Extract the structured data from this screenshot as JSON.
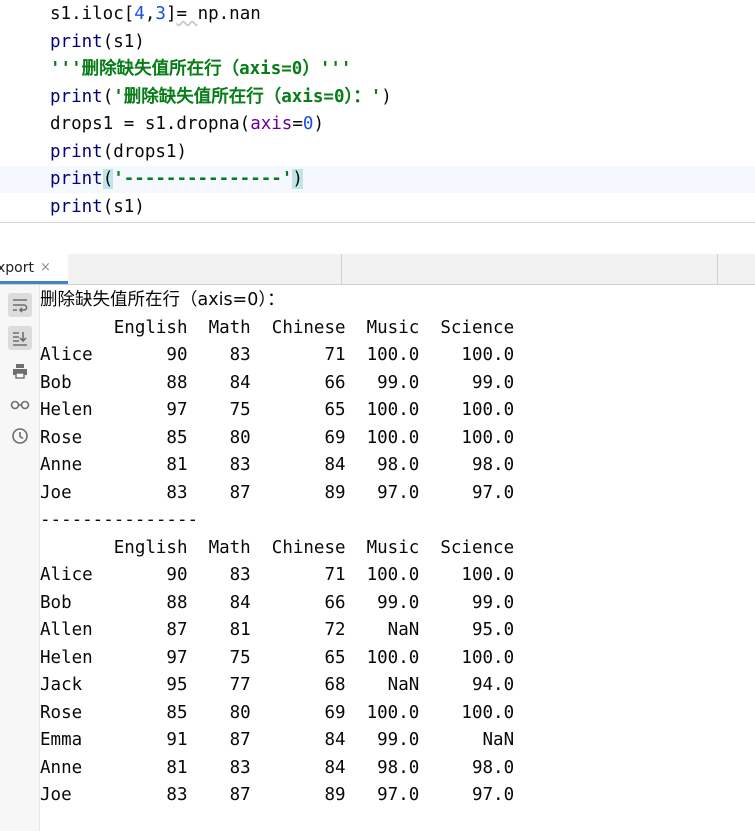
{
  "editor": {
    "lines": [
      {
        "id": "l1",
        "parts": [
          {
            "t": "s1.iloc[",
            "c": ""
          },
          {
            "t": "4",
            "c": "num"
          },
          {
            "t": ",",
            "c": ""
          },
          {
            "t": "3",
            "c": "num"
          },
          {
            "t": "]",
            "c": ""
          },
          {
            "t": "= ",
            "c": "squig"
          },
          {
            "t": "np.nan",
            "c": ""
          }
        ]
      },
      {
        "id": "l2",
        "parts": [
          {
            "t": "print",
            "c": "fn"
          },
          {
            "t": "(s1)",
            "c": ""
          }
        ]
      },
      {
        "id": "l3",
        "parts": [
          {
            "t": "'''删除缺失值所在行（axis=0）'''",
            "c": "str"
          }
        ]
      },
      {
        "id": "l4",
        "parts": [
          {
            "t": "print",
            "c": "fn"
          },
          {
            "t": "(",
            "c": ""
          },
          {
            "t": "'删除缺失值所在行（axis=0）：'",
            "c": "str"
          },
          {
            "t": ")",
            "c": ""
          }
        ]
      },
      {
        "id": "l5",
        "parts": [
          {
            "t": "drops1 = s1.dropna(",
            "c": ""
          },
          {
            "t": "axis",
            "c": "param"
          },
          {
            "t": "=",
            "c": ""
          },
          {
            "t": "0",
            "c": "num"
          },
          {
            "t": ")",
            "c": ""
          }
        ]
      },
      {
        "id": "l6",
        "parts": [
          {
            "t": "print",
            "c": "fn"
          },
          {
            "t": "(drops1)",
            "c": ""
          }
        ]
      },
      {
        "id": "l7",
        "parts": [
          {
            "t": "print",
            "c": "fn"
          },
          {
            "t": "(",
            "c": "paren-hl"
          },
          {
            "t": "'---------------'",
            "c": "str"
          },
          {
            "t": ")",
            "c": "paren-hl"
          }
        ]
      },
      {
        "id": "l8",
        "parts": [
          {
            "t": "print",
            "c": "fn"
          },
          {
            "t": "(s1)",
            "c": ""
          }
        ]
      }
    ]
  },
  "run_tab": {
    "label": "xport",
    "close": "×"
  },
  "tools": [
    {
      "name": "soft-wrap-icon",
      "active": true
    },
    {
      "name": "scroll-to-end-icon",
      "active": true
    },
    {
      "name": "print-icon",
      "active": false
    },
    {
      "name": "glasses-icon",
      "active": false
    },
    {
      "name": "clock-icon",
      "active": false
    }
  ],
  "console": {
    "heading": "删除缺失值所在行（axis=0）：",
    "table1": {
      "header": "       English  Math  Chinese  Music  Science",
      "rows": [
        "Alice       90    83       71  100.0    100.0",
        "Bob         88    84       66   99.0     99.0",
        "Helen       97    75       65  100.0    100.0",
        "Rose        85    80       69  100.0    100.0",
        "Anne        81    83       84   98.0     98.0",
        "Joe         83    87       89   97.0     97.0"
      ]
    },
    "separator": "---------------",
    "table2": {
      "header": "       English  Math  Chinese  Music  Science",
      "rows": [
        "Alice       90    83       71  100.0    100.0",
        "Bob         88    84       66   99.0     99.0",
        "Allen       87    81       72    NaN     95.0",
        "Helen       97    75       65  100.0    100.0",
        "Jack        95    77       68    NaN     94.0",
        "Rose        85    80       69  100.0    100.0",
        "Emma        91    87       84   99.0      NaN",
        "Anne        81    83       84   98.0     98.0",
        "Joe         83    87       89   97.0     97.0"
      ]
    }
  }
}
